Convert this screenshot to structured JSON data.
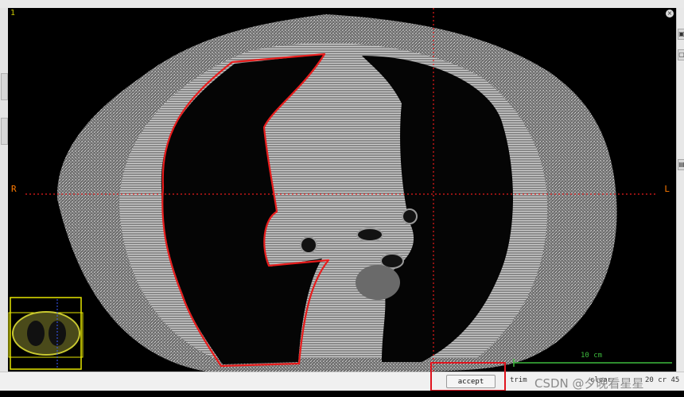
{
  "viewer": {
    "index_label": "1",
    "orient_right": "R",
    "orient_left": "L",
    "scale_label": "10 cm",
    "colors": {
      "crosshair": "#e81c1c",
      "contour": "#e81c1c",
      "orientation": "#ff7a00",
      "thumbnail_frame": "#e6e600",
      "scale_bar": "#3dbb3d"
    }
  },
  "status": {
    "accept_label": "accept",
    "trim_label": "trim",
    "clear_label": "clear",
    "tail_text": "20 cr 45",
    "watermark": "CSDN @夕晚看星星"
  },
  "icons": {
    "close": "close-icon",
    "tool_a": "tool-icon",
    "tool_b": "tool-icon-2"
  }
}
